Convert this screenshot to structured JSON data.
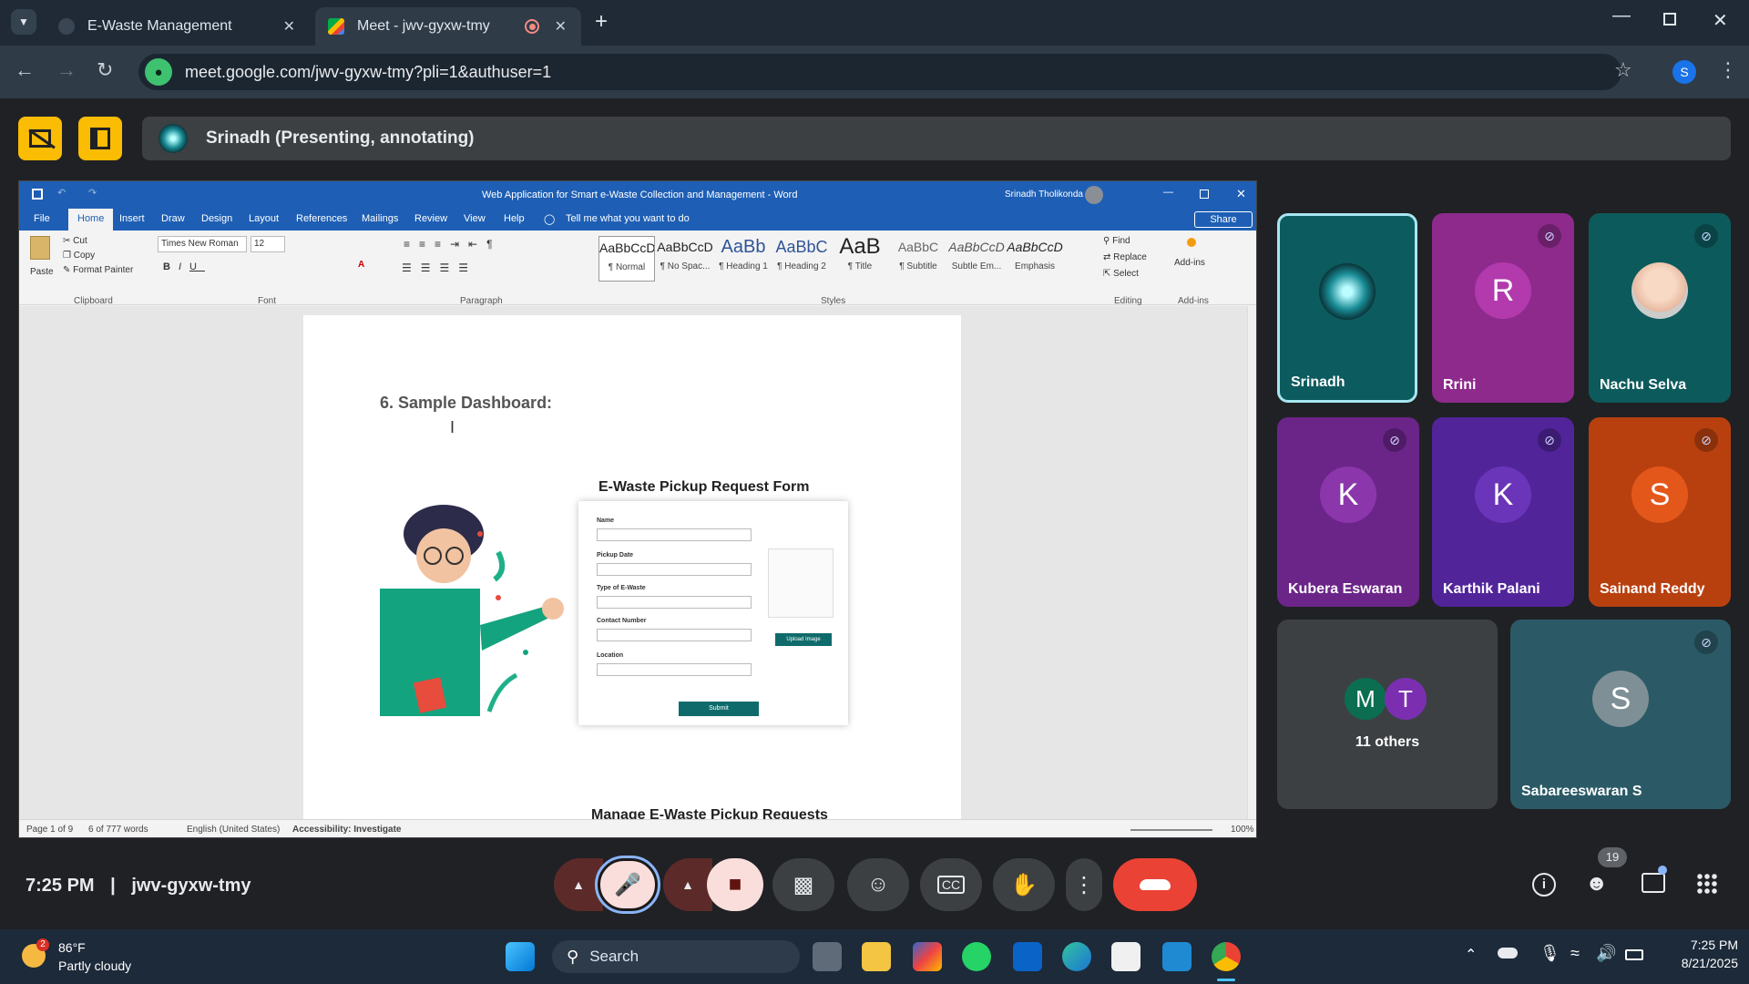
{
  "browser": {
    "tabs": [
      {
        "title": "E-Waste Management"
      },
      {
        "title": "Meet - jwv-gyxw-tmy"
      }
    ],
    "url": "meet.google.com/jwv-gyxw-tmy?pli=1&authuser=1",
    "profile_initial": "S"
  },
  "meet": {
    "presenter_banner": "Srinadh (Presenting, annotating)",
    "clock": "7:25 PM",
    "separator": "|",
    "meeting_code": "jwv-gyxw-tmy",
    "people_count": "19",
    "participants": [
      {
        "name": "Srinadh",
        "avatar": ""
      },
      {
        "name": "Rrini",
        "avatar": "R"
      },
      {
        "name": "Nachu Selva",
        "avatar": ""
      },
      {
        "name": "Kubera Eswaran",
        "avatar": "K"
      },
      {
        "name": "Karthik Palani",
        "avatar": "K"
      },
      {
        "name": "Sainand Reddy",
        "avatar": "S"
      },
      {
        "name": "11 others",
        "avatar": "M",
        "avatar2": "T"
      },
      {
        "name": "Sabareeswaran S",
        "avatar": "S"
      }
    ]
  },
  "word": {
    "title": "Web Application for Smart e-Waste Collection and Management  -  Word",
    "user": "Srinadh Tholikonda",
    "share": "Share",
    "tabs": [
      "File",
      "Home",
      "Insert",
      "Draw",
      "Design",
      "Layout",
      "References",
      "Mailings",
      "Review",
      "View",
      "Help"
    ],
    "tell_me": "Tell me what you want to do",
    "clipboard": {
      "paste": "Paste",
      "cut": "Cut",
      "copy": "Copy",
      "format_painter": "Format Painter",
      "group": "Clipboard"
    },
    "font": {
      "name": "Times New Roman",
      "size": "12",
      "group": "Font"
    },
    "paragraph_group": "Paragraph",
    "styles": [
      {
        "preview": "AaBbCcD",
        "label": "¶ Normal"
      },
      {
        "preview": "AaBbCcD",
        "label": "¶ No Spac..."
      },
      {
        "preview": "AaBb",
        "label": "¶ Heading 1"
      },
      {
        "preview": "AaBbC",
        "label": "¶ Heading 2"
      },
      {
        "preview": "AaB",
        "label": "¶ Title"
      },
      {
        "preview": "AaBbC",
        "label": "¶ Subtitle"
      },
      {
        "preview": "AaBbCcD",
        "label": "Subtle Em..."
      },
      {
        "preview": "AaBbCcD",
        "label": "Emphasis"
      }
    ],
    "styles_group": "Styles",
    "editing": {
      "find": "Find",
      "replace": "Replace",
      "select": "Select",
      "group": "Editing"
    },
    "addins": {
      "label": "Add-ins",
      "group": "Add-ins"
    },
    "doc": {
      "heading": "6. Sample Dashboard:",
      "form_title": "E-Waste Pickup Request Form",
      "fields": [
        "Name",
        "Pickup Date",
        "Type of E-Waste",
        "Contact Number",
        "Location"
      ],
      "upload": "Upload Image",
      "submit": "Submit",
      "next_heading": "Manage E-Waste Pickup Requests"
    },
    "status": {
      "page": "Page 1 of 9",
      "words": "6 of 777 words",
      "language": "English (United States)",
      "accessibility": "Accessibility: Investigate",
      "zoom": "100%"
    }
  },
  "taskbar": {
    "temp": "86°F",
    "weather": "Partly cloudy",
    "weather_badge": "2",
    "search": "Search",
    "time": "7:25 PM",
    "date": "8/21/2025"
  }
}
